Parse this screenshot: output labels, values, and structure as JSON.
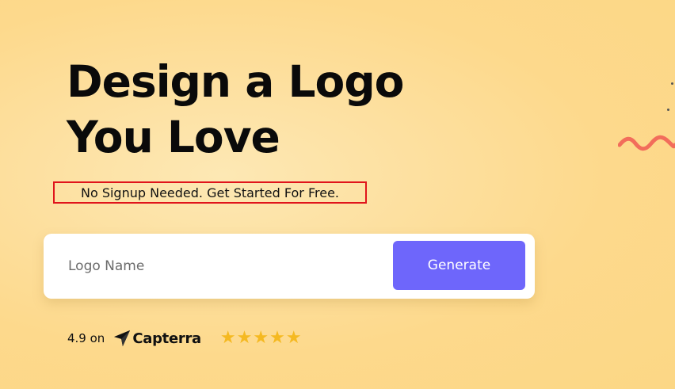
{
  "hero": {
    "headline_line1": "Design a Logo",
    "headline_line2": "You Love",
    "subtitle": "No Signup Needed. Get Started For Free."
  },
  "search": {
    "placeholder": "Logo Name",
    "value": "",
    "generate_label": "Generate"
  },
  "rating": {
    "score_text": "4.9 on",
    "platform": "Capterra",
    "stars": 5,
    "star_glyph": "★"
  },
  "colors": {
    "accent": "#6e66fb",
    "star": "#f5b921",
    "highlight_border": "#e0141b",
    "squiggle": "#f26d5b"
  }
}
